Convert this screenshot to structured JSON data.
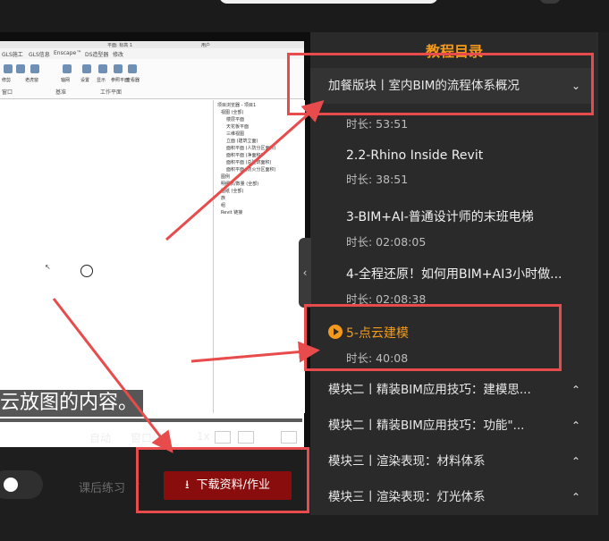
{
  "panel": {
    "title": "教程目录",
    "modules_top": [
      {
        "title": "加餐版块丨室内BIM的流程体系概况",
        "expanded": true
      }
    ],
    "lessons": [
      {
        "name": "",
        "duration": "时长: 53:51"
      },
      {
        "name": "2.2-Rhino Inside Revit",
        "duration": "时长: 38:51"
      },
      {
        "name": "3-BIM+AI-普通设计师的末班电梯",
        "duration": "时长: 02:08:05"
      },
      {
        "name": "4-全程还原！如何用BIM+AI3小时做...",
        "duration": "时长: 02:08:38"
      },
      {
        "name": "5-点云建模",
        "duration": "时长: 40:08",
        "active": true
      }
    ],
    "modules_bottom": [
      {
        "title": "模块二丨精装BIM应用技巧：建模思..."
      },
      {
        "title": "模块二丨精装BIM应用技巧：功能\"..."
      },
      {
        "title": "模块三丨渲染表现：材料体系"
      },
      {
        "title": "模块三丨渲染表现：灯光体系"
      }
    ],
    "collapse_glyph": "‹",
    "chevron_down": "⌄",
    "chevron_up": "⌃"
  },
  "video": {
    "subtitle": "云放图的内容。",
    "controls": {
      "auto": "自动",
      "window": "窗口",
      "screen": "屏",
      "speed": "1x"
    },
    "revit": {
      "tabs": [
        "GLS施工",
        "GLS信息",
        "Enscape™",
        "DS造型器",
        "修改"
      ],
      "titlebar": "平面: 标高 1",
      "user": "用户",
      "ribbon_labels": [
        "窗口",
        "基准",
        "工作平面"
      ],
      "ribbon_tool_labels": [
        "修剪",
        "老虎窗",
        "轴网",
        "设置",
        "显示",
        "参照平面",
        "查看器"
      ],
      "browser_title": "项目浏览器 - 项目1",
      "browser_rows": [
        "视图 (全部)",
        "楼层平面",
        "天花板平面",
        "三维视图",
        "立面 (建筑立面)",
        "面积平面 (人防分区面积)",
        "面积平面 (净面积)",
        "面积平面 (总建筑面积)",
        "面积平面 (防火分区面积)",
        "图例",
        "明细表/数量 (全部)",
        "图纸 (全部)",
        "族",
        "组",
        "Revit 链接"
      ]
    }
  },
  "bottombar": {
    "after_class": "课后练习",
    "after_chev": "›",
    "download_label": "下载资料/作业",
    "download_icon": "download-icon"
  },
  "colors": {
    "accent": "#f39a1a",
    "highlight": "#e84b4b",
    "download_bg": "#8a0d0d",
    "panel_bg": "#2a2a2a"
  }
}
